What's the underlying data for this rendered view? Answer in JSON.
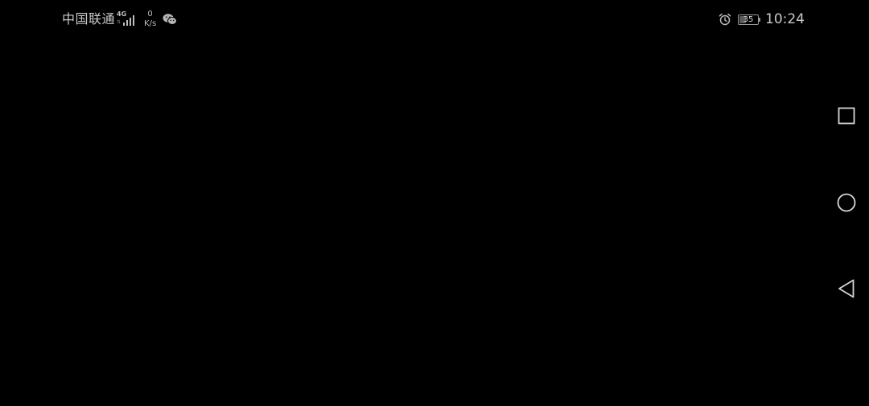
{
  "status_bar": {
    "carrier": "中国联通",
    "network_type": "4G",
    "signal_level": 1.0,
    "speed_value": "0",
    "speed_unit": "K/s",
    "notification_icon": "wechat-icon",
    "alarm_icon": "alarm-clock-icon",
    "battery_level": "35",
    "battery_fraction": 0.35,
    "time": "10:24"
  },
  "nav_bar": {
    "buttons": [
      {
        "name": "recents",
        "icon": "square-icon"
      },
      {
        "name": "home",
        "icon": "circle-icon"
      },
      {
        "name": "back",
        "icon": "triangle-back-icon"
      }
    ]
  },
  "colors": {
    "background": "#000000",
    "status_text": "#c8c8c8",
    "nav_icon": "#d6d6d6"
  }
}
